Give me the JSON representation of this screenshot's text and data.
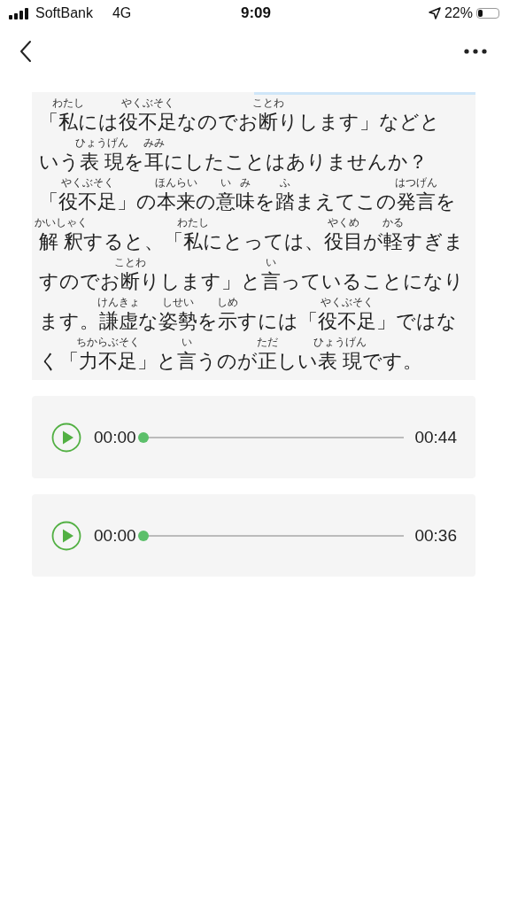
{
  "status_bar": {
    "carrier": "SoftBank",
    "network": "4G",
    "time": "9:09",
    "battery": "22%"
  },
  "passage": {
    "lines": [
      [
        {
          "text": "「"
        },
        {
          "text": "私",
          "ruby": "わたし"
        },
        {
          "text": "には"
        },
        {
          "text": "役不足",
          "ruby": "やくぶそく"
        },
        {
          "text": "なのでお"
        },
        {
          "text": "断",
          "ruby": "ことわ"
        },
        {
          "text": "りします」などと"
        }
      ],
      [
        {
          "text": "いう"
        },
        {
          "text": "表 現",
          "ruby": "ひょうげん"
        },
        {
          "text": "を"
        },
        {
          "text": "耳",
          "ruby": "みみ"
        },
        {
          "text": "にしたことはありませんか？"
        }
      ],
      [
        {
          "text": "「"
        },
        {
          "text": "役不足",
          "ruby": "やくぶそく"
        },
        {
          "text": "」の"
        },
        {
          "text": "本来",
          "ruby": "ほんらい"
        },
        {
          "text": "の"
        },
        {
          "text": "意",
          "ruby": "い"
        },
        {
          "text": "味",
          "ruby": "み"
        },
        {
          "text": "を"
        },
        {
          "text": "踏",
          "ruby": "ふ"
        },
        {
          "text": "まえてこの"
        },
        {
          "text": "発言",
          "ruby": "はつげん"
        },
        {
          "text": "を"
        }
      ],
      [
        {
          "text": "解 釈",
          "ruby": "かいしゃく"
        },
        {
          "text": "すると、「"
        },
        {
          "text": "私",
          "ruby": "わたし"
        },
        {
          "text": "にとっては、"
        },
        {
          "text": "役目",
          "ruby": "やくめ"
        },
        {
          "text": "が"
        },
        {
          "text": "軽",
          "ruby": "かる"
        },
        {
          "text": "すぎま"
        }
      ],
      [
        {
          "text": "すのでお"
        },
        {
          "text": "断",
          "ruby": "ことわ"
        },
        {
          "text": "りします」と"
        },
        {
          "text": "言",
          "ruby": "い"
        },
        {
          "text": "っていることになり"
        }
      ],
      [
        {
          "text": "ます。"
        },
        {
          "text": "謙虚",
          "ruby": "けんきょ"
        },
        {
          "text": "な"
        },
        {
          "text": "姿勢",
          "ruby": "しせい"
        },
        {
          "text": "を"
        },
        {
          "text": "示",
          "ruby": "しめ"
        },
        {
          "text": "すには「"
        },
        {
          "text": "役不足",
          "ruby": "やくぶそく"
        },
        {
          "text": "」ではな"
        }
      ],
      [
        {
          "text": "く「"
        },
        {
          "text": "力不足",
          "ruby": "ちからぶそく"
        },
        {
          "text": "」と"
        },
        {
          "text": "言",
          "ruby": "い"
        },
        {
          "text": "うのが"
        },
        {
          "text": "正",
          "ruby": "ただ"
        },
        {
          "text": "しい"
        },
        {
          "text": "表 現",
          "ruby": "ひょうげん"
        },
        {
          "text": "です。"
        }
      ]
    ]
  },
  "audio_players": [
    {
      "current_time": "00:00",
      "duration": "00:44",
      "level": 0,
      "playing": false
    },
    {
      "current_time": "00:00",
      "duration": "00:36",
      "level": 0,
      "playing": false
    }
  ]
}
